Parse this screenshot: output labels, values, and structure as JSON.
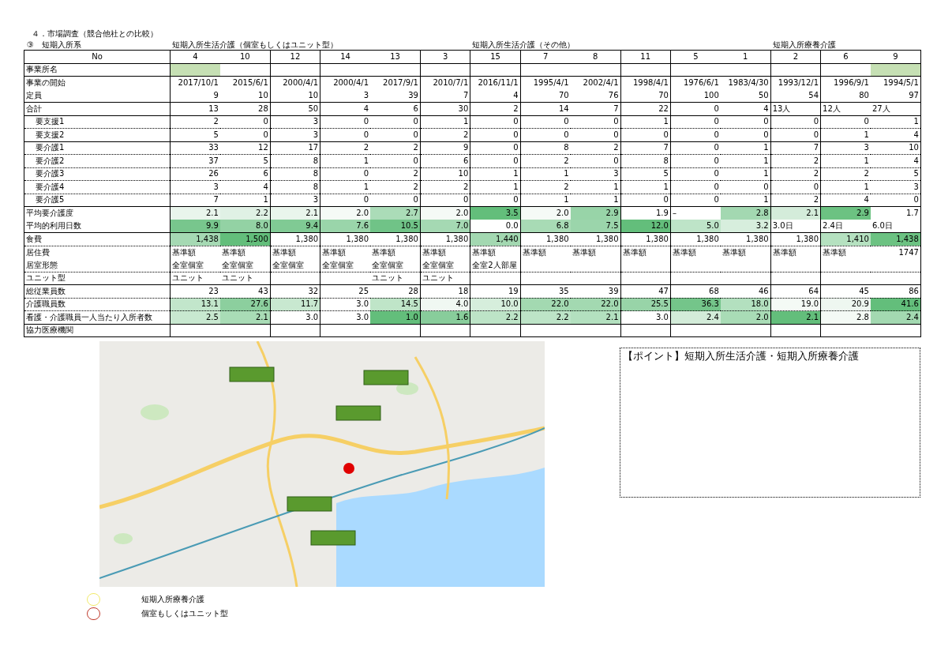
{
  "heading": "４．市場調査（競合他社との比較）",
  "section": "③　短期入所系",
  "table": {
    "corner": "No",
    "column_groups": [
      {
        "label": "短期入所生活介護（個室もしくはユニット型）",
        "columns": [
          "4",
          "10",
          "12",
          "14",
          "13",
          "3"
        ]
      },
      {
        "label": "短期入所生活介護（その他）",
        "columns": [
          "15",
          "7",
          "8",
          "11",
          "5",
          "1"
        ]
      },
      {
        "label": "短期入所療養介護",
        "columns": [
          "2",
          "6",
          "9"
        ]
      }
    ],
    "rows": [
      {
        "label": "事業所名",
        "kind": "text",
        "cells": [
          {
            "color": "#c6e0b4"
          },
          null,
          null,
          null,
          null,
          null,
          null,
          null,
          null,
          null,
          null,
          null,
          null,
          null,
          {
            "color": "#c6e0b4"
          }
        ]
      },
      {
        "label": "事業の開始",
        "kind": "number",
        "cells": [
          "2017/10/1",
          "2015/6/1",
          "2000/4/1",
          "2000/4/1",
          "2017/9/1",
          "2010/7/1",
          "2016/11/1",
          "1995/4/1",
          "2002/4/1",
          "1998/4/1",
          "1976/6/1",
          "1983/4/30",
          "1993/12/1",
          "1996/9/1",
          "1994/5/1"
        ]
      },
      {
        "label": "定員",
        "kind": "number",
        "cells": [
          "9",
          "10",
          "10",
          "3",
          "39",
          "7",
          "4",
          "70",
          "76",
          "70",
          "100",
          "50",
          "54",
          "80",
          "97"
        ]
      },
      {
        "label": "合計",
        "kind": "number",
        "cells": [
          "13",
          "28",
          "50",
          "4",
          "6",
          "30",
          "2",
          "14",
          "7",
          "22",
          "0",
          "4",
          {
            "text": "13人",
            "kind": "text"
          },
          {
            "text": "12人",
            "kind": "text"
          },
          {
            "text": "27人",
            "kind": "text"
          }
        ],
        "children": [
          {
            "label": "要支援1",
            "kind": "number",
            "cells": [
              "2",
              "0",
              "3",
              "0",
              "0",
              "1",
              "0",
              "0",
              "0",
              "1",
              "0",
              "0",
              "0",
              "0",
              "1"
            ]
          },
          {
            "label": "要支援2",
            "kind": "number",
            "cells": [
              "5",
              "0",
              "3",
              "0",
              "0",
              "2",
              "0",
              "0",
              "0",
              "0",
              "0",
              "0",
              "0",
              "1",
              "4"
            ]
          },
          {
            "label": "要介護1",
            "kind": "number",
            "cells": [
              "33",
              "12",
              "17",
              "2",
              "2",
              "9",
              "0",
              "8",
              "2",
              "7",
              "0",
              "1",
              "7",
              "3",
              "10"
            ]
          },
          {
            "label": "要介護2",
            "kind": "number",
            "cells": [
              "37",
              "5",
              "8",
              "1",
              "0",
              "6",
              "0",
              "2",
              "0",
              "8",
              "0",
              "1",
              "2",
              "1",
              "4"
            ]
          },
          {
            "label": "要介護3",
            "kind": "number",
            "cells": [
              "26",
              "6",
              "8",
              "0",
              "2",
              "10",
              "1",
              "1",
              "3",
              "5",
              "0",
              "1",
              "2",
              "2",
              "5"
            ]
          },
          {
            "label": "要介護4",
            "kind": "number",
            "cells": [
              "3",
              "4",
              "8",
              "1",
              "2",
              "2",
              "1",
              "2",
              "1",
              "1",
              "0",
              "0",
              "0",
              "1",
              "3"
            ]
          },
          {
            "label": "要介護5",
            "kind": "number",
            "cells": [
              "7",
              "1",
              "3",
              "0",
              "0",
              "0",
              "0",
              "1",
              "1",
              "0",
              "0",
              "1",
              "2",
              "4",
              "0"
            ]
          }
        ]
      },
      {
        "label": "平均要介護度",
        "kind": "number",
        "cells": [
          {
            "text": "2.1",
            "color": "#e9f5ec"
          },
          {
            "text": "2.2",
            "color": "#e0f1e5"
          },
          {
            "text": "2.1",
            "color": "#e9f5ec"
          },
          {
            "text": "2.0",
            "color": "#f5faf6"
          },
          {
            "text": "2.7",
            "color": "#abdcb8"
          },
          {
            "text": "2.0",
            "color": "#f5faf6"
          },
          {
            "text": "3.5",
            "color": "#63be7b"
          },
          {
            "text": "2.0",
            "color": "#f5faf6"
          },
          {
            "text": "2.9",
            "color": "#98d4a8"
          },
          "1.9",
          {
            "text": "–",
            "kind": "text"
          },
          {
            "text": "2.8",
            "color": "#a3d8b1"
          },
          {
            "text": "2.1",
            "color": "#d4ecda"
          },
          {
            "text": "2.9",
            "color": "#6cc282"
          },
          "1.7"
        ]
      },
      {
        "label": "平均的利用日数",
        "kind": "number",
        "cells": [
          {
            "text": "9.9",
            "color": "#78c68d"
          },
          {
            "text": "8.0",
            "color": "#93d2a4"
          },
          {
            "text": "9.4",
            "color": "#80ca94"
          },
          {
            "text": "7.6",
            "color": "#9ad5aa"
          },
          {
            "text": "10.5",
            "color": "#70c387"
          },
          {
            "text": "7.0",
            "color": "#a5d9b3"
          },
          "0.0",
          {
            "text": "6.8",
            "color": "#a8dbb5"
          },
          {
            "text": "7.5",
            "color": "#9bd5ab"
          },
          {
            "text": "12.0",
            "color": "#63be7b"
          },
          {
            "text": "5.0",
            "color": "#bee4c8"
          },
          {
            "text": "3.2",
            "color": "#d7eedd"
          },
          {
            "text": "3.0日",
            "kind": "text"
          },
          {
            "text": "2.4日",
            "kind": "text"
          },
          {
            "text": "6.0日",
            "kind": "text"
          }
        ]
      },
      {
        "label": "食費",
        "kind": "number",
        "cells": [
          {
            "text": "1,438",
            "color": "#a5d9b3"
          },
          {
            "text": "1,500",
            "color": "#63be7b"
          },
          "1,380",
          "1,380",
          "1,380",
          "1,380",
          {
            "text": "1,440",
            "color": "#a3d8b1"
          },
          "1,380",
          "1,380",
          "1,380",
          "1,380",
          "1,380",
          "1,380",
          {
            "text": "1,410",
            "color": "#b5e1c0"
          },
          {
            "text": "1,438",
            "color": "#6cc282"
          }
        ]
      },
      {
        "label": "居住費",
        "kind": "text",
        "cells": [
          "基準額",
          "基準額",
          "基準額",
          "基準額",
          "基準額",
          "基準額",
          "基準額",
          "基準額",
          "基準額",
          "基準額",
          "基準額",
          "基準額",
          "基準額",
          "基準額",
          {
            "text": "1747",
            "kind": "number"
          }
        ]
      },
      {
        "label": "居室形態",
        "kind": "text",
        "cells": [
          "全室個室",
          "全室個室",
          "全室個室",
          "全室個室",
          "全室個室",
          "全室個室",
          "全室2人部屋",
          null,
          null,
          null,
          null,
          null,
          null,
          null,
          null
        ]
      },
      {
        "label": "ユニット型",
        "kind": "text",
        "cells": [
          "ユニット",
          "ユニット",
          null,
          null,
          "ユニット",
          "ユニット",
          null,
          null,
          null,
          null,
          null,
          null,
          null,
          null,
          null
        ]
      },
      {
        "label": "総従業員数",
        "kind": "number",
        "cells": [
          "23",
          "43",
          "32",
          "25",
          "28",
          "18",
          "19",
          "35",
          "39",
          "47",
          "68",
          "46",
          "64",
          "45",
          "86"
        ]
      },
      {
        "label": "介護職員数",
        "kind": "number",
        "cells": [
          {
            "text": "13.1",
            "color": "#c2e6cb"
          },
          {
            "text": "27.6",
            "color": "#8ccf9e"
          },
          {
            "text": "11.7",
            "color": "#c8e8d0"
          },
          "3.0",
          {
            "text": "14.5",
            "color": "#bfe5c8"
          },
          {
            "text": "4.0",
            "color": "#f0f8f2"
          },
          {
            "text": "10.0",
            "color": "#d6eedc"
          },
          {
            "text": "22.0",
            "color": "#a3d9b1"
          },
          {
            "text": "22.0",
            "color": "#a3d9b1"
          },
          {
            "text": "25.5",
            "color": "#98d4a8"
          },
          {
            "text": "36.3",
            "color": "#74c58a"
          },
          {
            "text": "18.0",
            "color": "#b3e0bf"
          },
          {
            "text": "19.0",
            "color": "#f4faf5"
          },
          {
            "text": "20.9",
            "color": "#eef7f0"
          },
          {
            "text": "41.6",
            "color": "#63be7b"
          }
        ]
      },
      {
        "label": "看護・介護職員一人当たり入所者数",
        "kind": "number",
        "cells": [
          {
            "text": "2.5",
            "color": "#c8e8d0"
          },
          {
            "text": "2.1",
            "color": "#a9dcb6"
          },
          "3.0",
          "3.0",
          {
            "text": "1.0",
            "color": "#63be7b"
          },
          {
            "text": "1.6",
            "color": "#88cd9b"
          },
          {
            "text": "2.2",
            "color": "#bde4c7"
          },
          {
            "text": "2.2",
            "color": "#bde4c7"
          },
          {
            "text": "2.1",
            "color": "#b3e0bf"
          },
          "3.0",
          {
            "text": "2.4",
            "color": "#d3ecd9"
          },
          {
            "text": "2.0",
            "color": "#a9dcb6"
          },
          {
            "text": "2.1",
            "color": "#63be7b"
          },
          {
            "text": "2.8",
            "color": "#f4faf5"
          },
          {
            "text": "2.4",
            "color": "#a3d9b1"
          }
        ]
      },
      {
        "label": "協力医療機関"
      }
    ]
  },
  "legend": [
    {
      "label": "短期入所療養介護",
      "color": "#f2ea6a"
    },
    {
      "label": "個室もしくはユニット型",
      "color": "#c0392b"
    }
  ],
  "point_box": {
    "text": "【ポイント】短期入所生活介護・短期入所療養介護"
  }
}
